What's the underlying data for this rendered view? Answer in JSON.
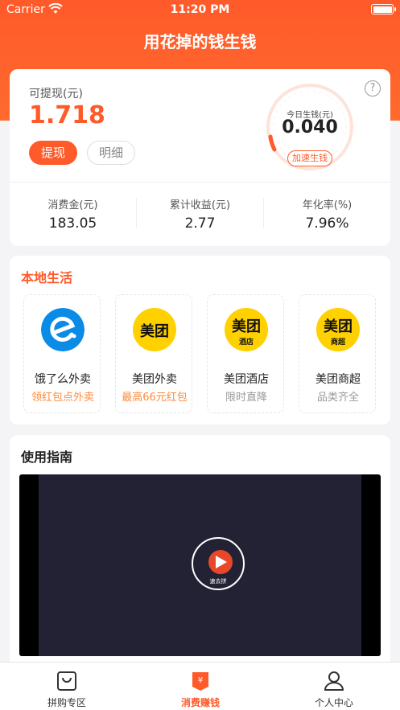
{
  "status_bar": {
    "carrier": "Carrier",
    "time": "11:20 PM"
  },
  "header": {
    "title": "用花掉的钱生钱"
  },
  "wallet": {
    "withdrawable_label": "可提现(元)",
    "withdrawable_value": "1.718",
    "withdraw_button": "提现",
    "detail_button": "明细",
    "today_label": "今日生钱(元)",
    "today_value": "0.040",
    "speed_button": "加速生钱",
    "stats": [
      {
        "label": "消费金(元)",
        "value": "183.05"
      },
      {
        "label": "累计收益(元)",
        "value": "2.77"
      },
      {
        "label": "年化率(%)",
        "value": "7.96%"
      }
    ]
  },
  "local": {
    "title": "本地生活",
    "services": [
      {
        "name": "饿了么外卖",
        "desc": "领红包点外卖",
        "logo_text": "",
        "logo_sub": "",
        "desc_color": "#ff8a3a"
      },
      {
        "name": "美团外卖",
        "desc": "最高66元红包",
        "logo_text": "美团",
        "logo_sub": "",
        "desc_color": "#ff8a3a"
      },
      {
        "name": "美团酒店",
        "desc": "限时直降",
        "logo_text": "美团",
        "logo_sub": "酒店",
        "desc_color": "#999999"
      },
      {
        "name": "美团商超",
        "desc": "品类齐全",
        "logo_text": "美团",
        "logo_sub": "商超",
        "desc_color": "#999999"
      }
    ]
  },
  "guide": {
    "title": "使用指南",
    "video_label": "速去拼"
  },
  "tabs": [
    {
      "label": "拼购专区",
      "icon": "bag-icon"
    },
    {
      "label": "消费赚钱",
      "icon": "yuan-tag-icon"
    },
    {
      "label": "个人中心",
      "icon": "person-icon"
    }
  ],
  "colors": {
    "accent": "#ff5a2a",
    "meituan_yellow": "#ffd100",
    "eleme_blue": "#0a8be6"
  }
}
